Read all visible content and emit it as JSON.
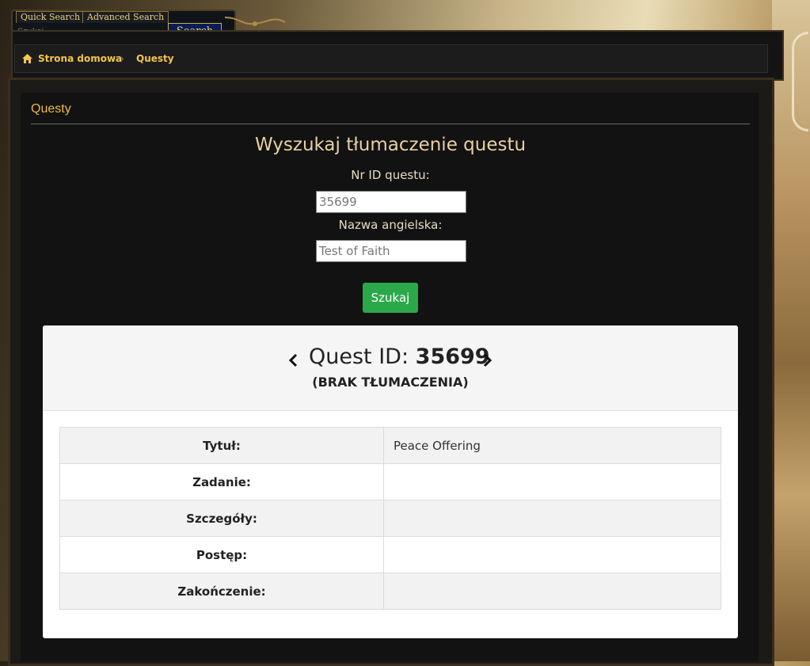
{
  "search": {
    "quick_tab": "Quick Search",
    "advanced_tab": "Advanced Search",
    "placeholder": "Szukaj...",
    "button": "Search"
  },
  "breadcrumb": {
    "home": "Strona domowa",
    "separator": "›",
    "current": "Questy"
  },
  "section": {
    "title": "Questy"
  },
  "form": {
    "title": "Wyszukaj tłumaczenie questu",
    "id_label": "Nr ID questu:",
    "id_value": "35699",
    "name_label": "Nazwa angielska:",
    "name_value": "Test of Faith",
    "submit": "Szukaj"
  },
  "result": {
    "id_prefix": "Quest ID: ",
    "id": "35699",
    "status": "(BRAK TŁUMACZENIA)",
    "rows": [
      {
        "label": "Tytuł:",
        "value": "Peace Offering"
      },
      {
        "label": "Zadanie:",
        "value": ""
      },
      {
        "label": "Szczegóły:",
        "value": ""
      },
      {
        "label": "Postęp:",
        "value": ""
      },
      {
        "label": "Zakończenie:",
        "value": ""
      }
    ]
  },
  "colors": {
    "accent_gold": "#f3c54b",
    "button_green": "#2ba84a",
    "search_button_blue": "#0a1c55"
  }
}
